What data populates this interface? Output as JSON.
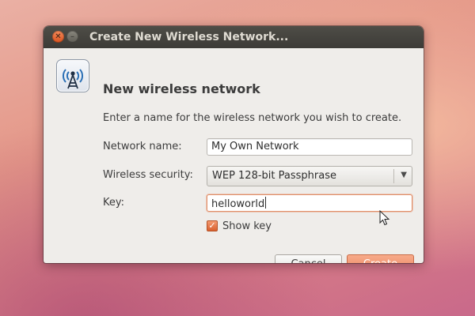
{
  "window": {
    "title": "Create New Wireless Network..."
  },
  "dialog": {
    "icon": "wireless-network-icon",
    "heading": "New wireless network",
    "description": "Enter a name for the wireless network you wish to create.",
    "network_name": {
      "label": "Network name:",
      "value": "My Own Network"
    },
    "security": {
      "label": "Wireless security:",
      "selected": "WEP 128-bit Passphrase"
    },
    "key": {
      "label": "Key:",
      "value": "helloworld"
    },
    "show_key": {
      "label": "Show key",
      "checked": true
    },
    "buttons": {
      "cancel": "Cancel",
      "create": "Create"
    }
  },
  "colors": {
    "accent": "#ec8460",
    "titlebar": "#3c3b37",
    "dialog_bg": "#efedea"
  }
}
